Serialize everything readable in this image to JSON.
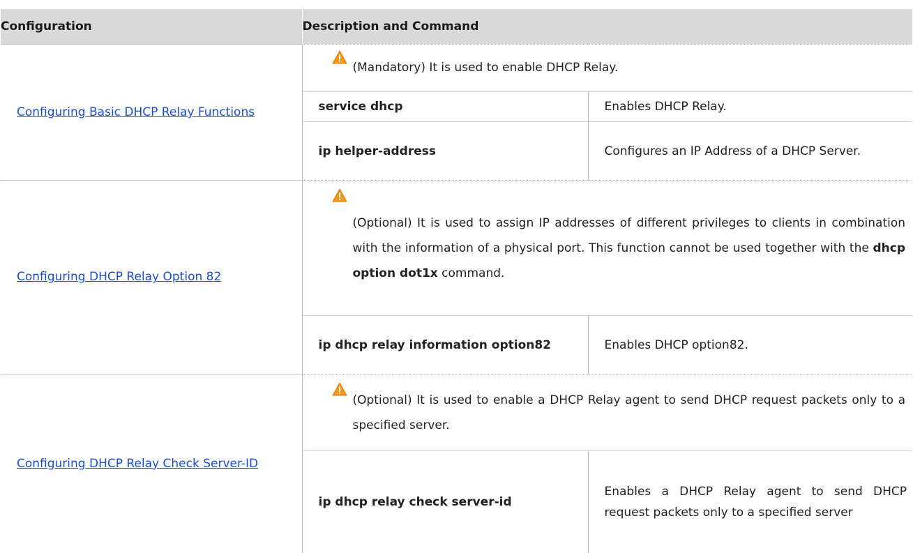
{
  "header": {
    "col1": "Configuration",
    "col2": "Description and Command"
  },
  "sections": [
    {
      "link": "Configuring Basic DHCP Relay Functions",
      "note": "(Mandatory) It is used to enable DHCP Relay.",
      "commands": [
        {
          "command": "service dhcp",
          "description": "Enables DHCP Relay."
        },
        {
          "command": "ip helper-address",
          "description": "Configures an IP Address of a DHCP Server."
        }
      ]
    },
    {
      "link": "Configuring DHCP Relay Option 82",
      "note_prefix": "(Optional) It is used to assign IP addresses of different privileges to clients in combination with the information of a physical port. This function cannot be used together with the ",
      "note_bold": "dhcp option dot1x",
      "note_suffix": " command.",
      "commands": [
        {
          "command": "ip dhcp relay information option82",
          "description": "Enables DHCP option82."
        }
      ]
    },
    {
      "link": "Configuring DHCP Relay Check Server-ID",
      "note": "(Optional) It is used to enable a DHCP Relay agent to send DHCP request packets only to a specified server.",
      "commands": [
        {
          "command": "ip dhcp relay check server-id",
          "description": "Enables a DHCP Relay agent to send DHCP request packets only to a specified server"
        }
      ]
    }
  ],
  "colors": {
    "header_bg": "#d9d9d9",
    "link": "#1a4fd6",
    "warning": "#f39a1e"
  },
  "icons": [
    "warning-icon"
  ]
}
